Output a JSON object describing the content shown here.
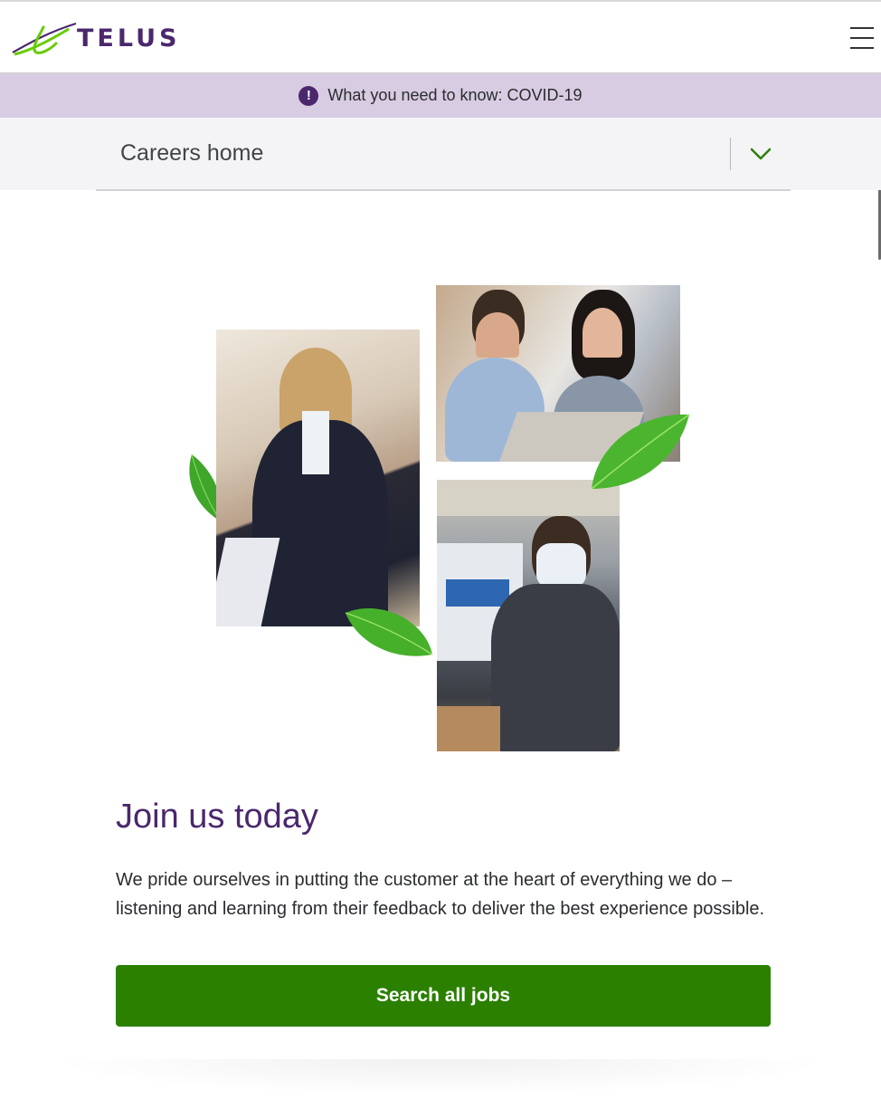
{
  "header": {
    "logo_text": "TELUS",
    "menu_icon": "hamburger-menu-icon"
  },
  "banner": {
    "icon": "exclamation-circle-icon",
    "icon_glyph": "!",
    "text": "What you need to know: COVID-19"
  },
  "careers_nav": {
    "label": "Careers home",
    "icon": "chevron-down-icon"
  },
  "hero": {
    "title": "Join us today",
    "description": "We pride ourselves in putting the customer at the heart of everything we do – listening and learning from their feedback to deliver the best experience possible.",
    "cta_label": "Search all jobs"
  },
  "colors": {
    "brand_purple": "#4b286d",
    "brand_green": "#2b8000",
    "banner_bg": "#d8cce3",
    "nav_bg": "#f4f4f7"
  }
}
